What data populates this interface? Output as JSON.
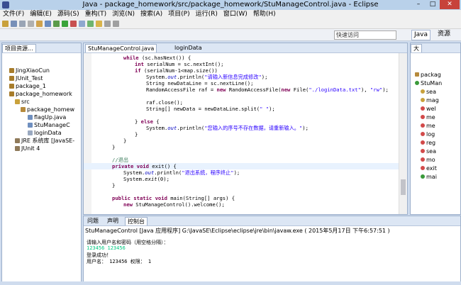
{
  "window": {
    "title": "Java - package_homework/src/package_homework/StuManageControl.java - Eclipse",
    "minimize": "–",
    "maximize": "□",
    "close": "✕"
  },
  "menu": [
    "文件(F)",
    "编辑(E)",
    "源码(S)",
    "重构(T)",
    "浏览(N)",
    "搜索(A)",
    "项目(P)",
    "运行(R)",
    "窗口(W)",
    "帮助(H)"
  ],
  "toolbar": {
    "quick_access_placeholder": "快速访问",
    "perspective_java": "Java",
    "perspective_resource": "资源"
  },
  "project_explorer": {
    "tab_label": "项目资源...",
    "items": [
      {
        "label": "JingXiaoCun"
      },
      {
        "label": "JUnit_Test"
      },
      {
        "label": "package_1"
      },
      {
        "label": "package_homework"
      },
      {
        "label": "src"
      },
      {
        "label": "package_homew"
      },
      {
        "label": "flagUp.java"
      },
      {
        "label": "StuManageC"
      },
      {
        "label": "loginData"
      },
      {
        "label": "JRE 系统库 [JavaSE-"
      },
      {
        "label": "JUnit 4"
      }
    ]
  },
  "editor": {
    "tabs": [
      {
        "label": "StuManageControl.java"
      },
      {
        "label": "loginData"
      }
    ]
  },
  "outline": {
    "tab_label": "大",
    "items": [
      {
        "label": "packag"
      },
      {
        "label": "StuMan"
      },
      {
        "label": "sea"
      },
      {
        "label": "mag"
      },
      {
        "label": "wel"
      },
      {
        "label": "me"
      },
      {
        "label": "me"
      },
      {
        "label": "log"
      },
      {
        "label": "reg"
      },
      {
        "label": "sea"
      },
      {
        "label": "mo"
      },
      {
        "label": "exit"
      },
      {
        "label": "mai"
      }
    ]
  },
  "console": {
    "tabs": [
      {
        "label": "问题"
      },
      {
        "label": "声明"
      },
      {
        "label": "控制台"
      }
    ],
    "info": "StuManageControl [Java 应用程序] G:\\JavaSE\\Eclipse\\eclipse\\jre\\bin\\javaw.exe ( 2015年5月17日 下午6:57:51 )",
    "lines": [
      {
        "text": "请输入用户名和密码（用空格分隔）："
      },
      {
        "text": "123456 123456"
      },
      {
        "text": "登录成功！"
      },
      {
        "text": "用户名： 123456  权限： 1"
      }
    ]
  },
  "colors": {
    "keyword": "#7f0055",
    "string": "#2a00ff",
    "comment": "#3f7f5f",
    "field": "#0000c0",
    "console_input": "#00c880"
  }
}
